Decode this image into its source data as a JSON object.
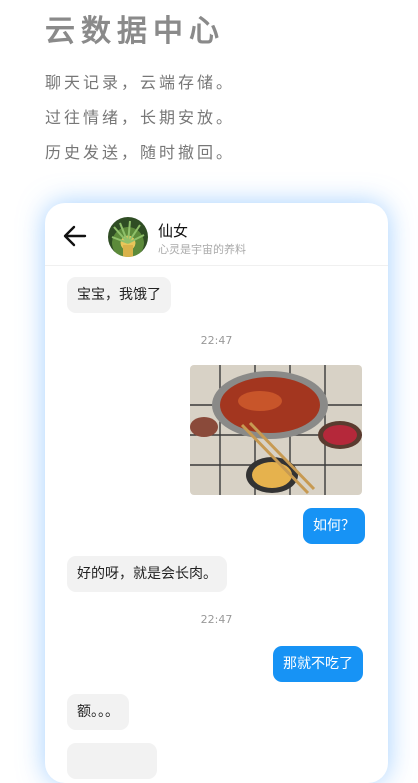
{
  "hero": {
    "title": "云数据中心",
    "lines": [
      "聊天记录，云端存储。",
      "过往情绪，长期安放。",
      "历史发送，随时撤回。"
    ]
  },
  "chat": {
    "contact_name": "仙女",
    "contact_status": "心灵是宇宙的养料",
    "messages": [
      {
        "side": "in",
        "text": "宝宝，我饿了"
      },
      {
        "type": "time",
        "text": "22:47"
      },
      {
        "side": "out",
        "type": "image",
        "icon": "hotpot-photo"
      },
      {
        "side": "out",
        "text": "如何？"
      },
      {
        "side": "in",
        "text": "好的呀，就是会长肉。"
      },
      {
        "type": "time",
        "text": "22:47"
      },
      {
        "side": "out",
        "text": "那就不吃了"
      },
      {
        "side": "in",
        "text": "额。。。"
      }
    ]
  },
  "colors": {
    "accent": "#1793f5",
    "incoming_bubble": "#f2f2f2",
    "title": "#8a8a8a"
  }
}
